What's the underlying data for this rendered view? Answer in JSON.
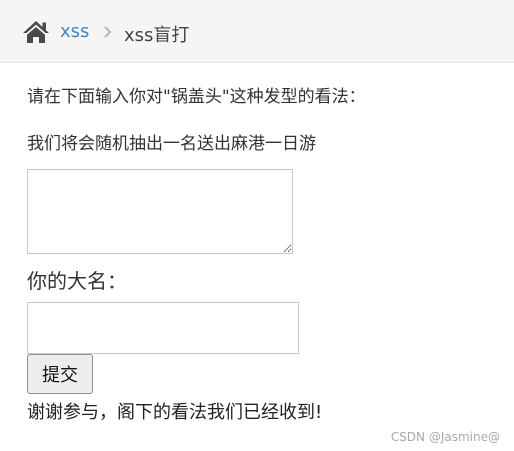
{
  "breadcrumb": {
    "home_icon": "home-icon",
    "link_label": "xss",
    "separator_icon": "chevron-right-icon",
    "current_label": "xss盲打"
  },
  "content": {
    "prompt": "请在下面输入你对\"锅盖头\"这种发型的看法：",
    "prize": "我们将会随机抽出一名送出麻港一日游",
    "opinion_value": "",
    "name_label": "你的大名：",
    "name_value": "",
    "submit_label": "提交",
    "thanks": "谢谢参与，阁下的看法我们已经收到!"
  },
  "watermark": "CSDN @Jasmine@",
  "colors": {
    "link": "#3f86c1",
    "header_bg": "#f5f5f5",
    "icon": "#4a4a4a"
  }
}
